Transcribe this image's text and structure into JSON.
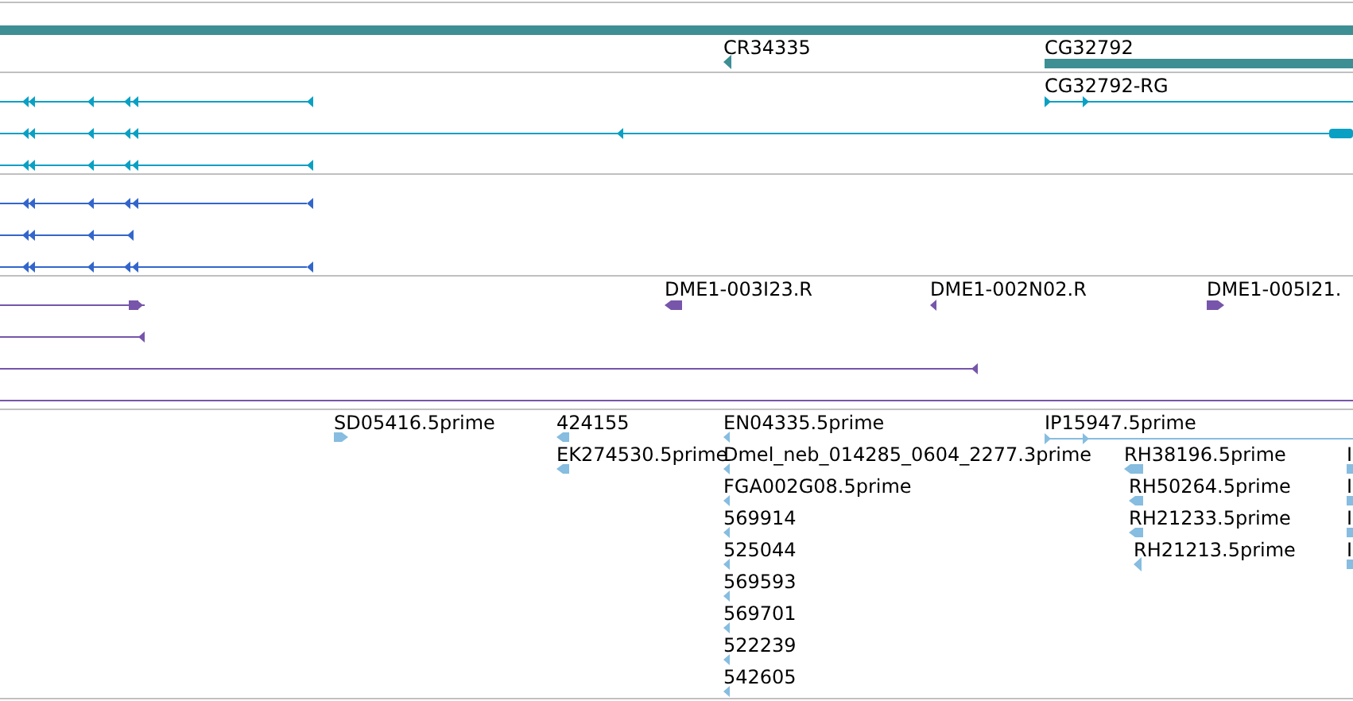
{
  "tracks": [
    {
      "color": "#3d8f94",
      "features": [
        {
          "kind": "bar"
        },
        {
          "kind": "read",
          "label": "CR34335",
          "reverse": true
        },
        {
          "kind": "bar",
          "label": "CG32792"
        }
      ]
    },
    {
      "color": "#0aa0c4",
      "features": [
        {
          "kind": "transcript",
          "reverse": true
        },
        {
          "kind": "transcript",
          "label": "CG32792-RG",
          "reverse": false
        },
        {
          "kind": "transcript",
          "reverse": true
        },
        {
          "kind": "transcript",
          "reverse": true
        }
      ]
    },
    {
      "color": "#3366cc",
      "features": [
        {
          "kind": "transcript",
          "reverse": true
        },
        {
          "kind": "transcript",
          "reverse": true
        },
        {
          "kind": "transcript",
          "reverse": true
        }
      ]
    },
    {
      "color": "#7755aa",
      "features": [
        {
          "kind": "transcript",
          "reverse": false
        },
        {
          "kind": "read",
          "label": "DME1-003I23.R",
          "reverse": true
        },
        {
          "kind": "read",
          "label": "DME1-002N02.R",
          "reverse": true
        },
        {
          "kind": "read",
          "label": "DME1-005I21.",
          "reverse": false
        },
        {
          "kind": "transcript",
          "reverse": true
        },
        {
          "kind": "transcript",
          "reverse": true
        },
        {
          "kind": "transcript"
        }
      ]
    },
    {
      "color": "#86bde0",
      "features": [
        {
          "kind": "read",
          "label": "SD05416.5prime",
          "reverse": false
        },
        {
          "kind": "read",
          "label": "424155",
          "reverse": true
        },
        {
          "kind": "read",
          "label": "EK274530.5prime",
          "reverse": true
        },
        {
          "kind": "read",
          "label": "EN04335.5prime",
          "reverse": true
        },
        {
          "kind": "read",
          "label": "Dmel_neb_014285_0604_2277.3prime",
          "reverse": true
        },
        {
          "kind": "read",
          "label": "FGA002G08.5prime",
          "reverse": true
        },
        {
          "kind": "read",
          "label": "569914",
          "reverse": true
        },
        {
          "kind": "read",
          "label": "525044",
          "reverse": true
        },
        {
          "kind": "read",
          "label": "569593",
          "reverse": true
        },
        {
          "kind": "read",
          "label": "569701",
          "reverse": true
        },
        {
          "kind": "read",
          "label": "522239",
          "reverse": true
        },
        {
          "kind": "read",
          "label": "542605",
          "reverse": true
        },
        {
          "kind": "transcript",
          "label": "IP15947.5prime",
          "reverse": false
        },
        {
          "kind": "read",
          "label": "RH38196.5prime",
          "reverse": true
        },
        {
          "kind": "read",
          "label": "RH50264.5prime",
          "reverse": true
        },
        {
          "kind": "read",
          "label": "RH21233.5prime",
          "reverse": true
        },
        {
          "kind": "read",
          "label": "RH21213.5prime",
          "reverse": true
        },
        {
          "kind": "read",
          "label": "I"
        },
        {
          "kind": "read",
          "label": "I"
        },
        {
          "kind": "read",
          "label": "I"
        },
        {
          "kind": "read",
          "label": "I"
        }
      ]
    }
  ]
}
